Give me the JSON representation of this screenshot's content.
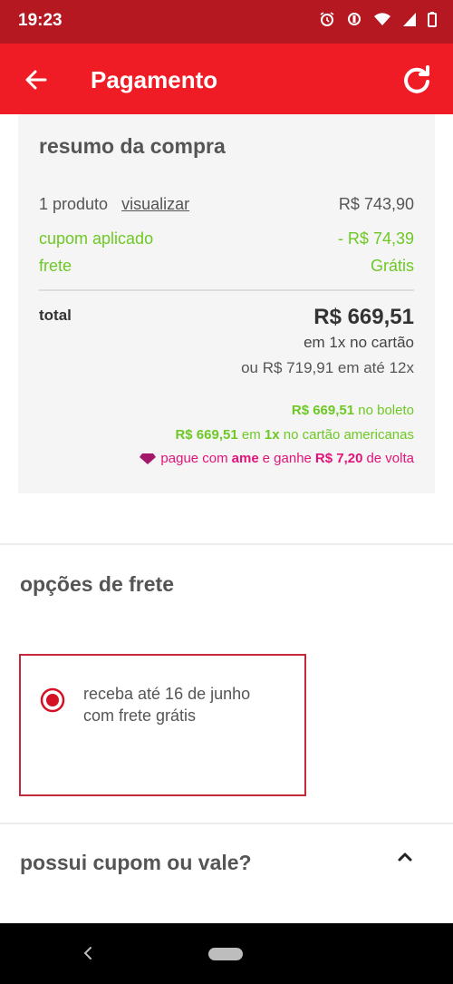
{
  "status_bar": {
    "time": "19:23",
    "icons": [
      "alarm-icon",
      "vibrate-icon",
      "wifi-icon",
      "signal-icon",
      "battery-icon"
    ]
  },
  "app_bar": {
    "title": "Pagamento",
    "back_icon": "arrow-left-icon",
    "refresh_icon": "refresh-icon",
    "color": "#ef1c25"
  },
  "summary": {
    "title": "resumo da compra",
    "product_count": "1 produto",
    "view_link": "visualizar",
    "product_price": "R$ 743,90",
    "coupon_label": "cupom aplicado",
    "coupon_value": "- R$ 74,39",
    "shipping_label": "frete",
    "shipping_value": "Grátis",
    "total_label": "total",
    "total_value": "R$ 669,51",
    "total_sub1": "em 1x no cartão",
    "total_sub2": "ou R$ 719,91 em até 12x",
    "boleto_amount": "R$ 669,51",
    "boleto_text": "no boleto",
    "card_amount": "R$ 669,51",
    "card_text1": "em",
    "card_installments": "1x",
    "card_text2": "no cartão americanas",
    "ame_text1": "pague com",
    "ame_brand": "ame",
    "ame_text2": "e ganhe",
    "ame_cashback": "R$ 7,20",
    "ame_text3": "de volta",
    "accent_green": "#6ec924",
    "accent_pink": "#e2147a"
  },
  "shipping_options": {
    "title": "opções de frete",
    "option_line1": "receba até 16 de junho",
    "option_line2": "com frete grátis"
  },
  "coupon": {
    "title": "possui cupom ou vale?",
    "toggle_icon": "chevron-up-icon"
  },
  "nav_bar": {
    "back_icon": "nav-back-icon",
    "home_icon": "home-pill-icon"
  }
}
